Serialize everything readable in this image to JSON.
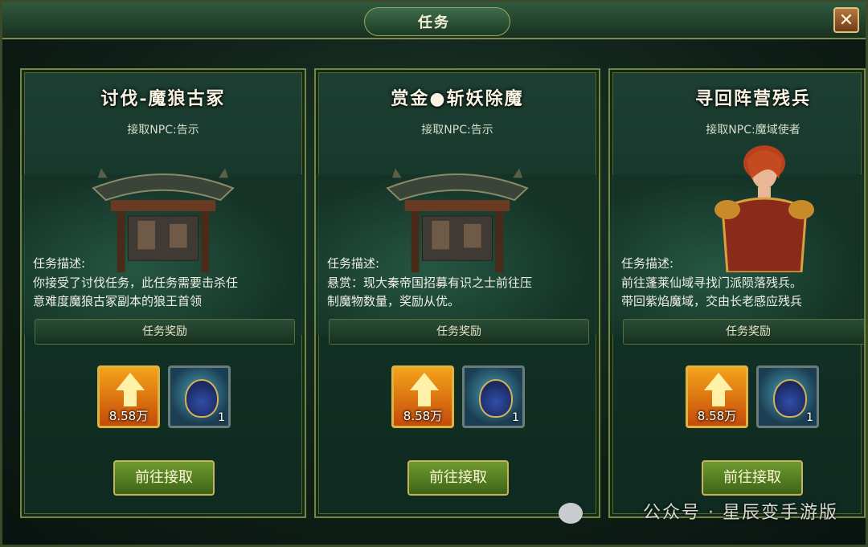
{
  "window": {
    "title": "任务",
    "close_icon": "close-icon"
  },
  "cards": [
    {
      "title": "讨伐-魔狼古冢",
      "npc_label": "接取NPC:",
      "npc_name": "告示",
      "art": "notice-board-icon",
      "desc_label": "任务描述:",
      "desc_lines": [
        "你接受了讨伐任务，此任务需要击杀任",
        "意难度魔狼古冢副本的狼王首领"
      ],
      "reward_label": "任务奖励",
      "exp_amount": "8.58万",
      "item_count": "1",
      "button_label": "前往接取"
    },
    {
      "title": "赏金●斩妖除魔",
      "npc_label": "接取NPC:",
      "npc_name": "告示",
      "art": "notice-board-icon",
      "desc_label": "任务描述:",
      "desc_lines": [
        "悬赏：现大秦帝国招募有识之士前往压",
        "制魔物数量，奖励从优。"
      ],
      "reward_label": "任务奖励",
      "exp_amount": "8.58万",
      "item_count": "1",
      "button_label": "前往接取"
    },
    {
      "title": "寻回阵营残兵",
      "npc_label": "接取NPC:",
      "npc_name": "魔域使者",
      "art": "npc-portrait-icon",
      "desc_label": "任务描述:",
      "desc_lines": [
        "前往蓬莱仙域寻找门派陨落残兵。",
        "带回紫焰魔域，交由长老感应残兵"
      ],
      "reward_label": "任务奖励",
      "exp_amount": "8.58万",
      "item_count": "1",
      "button_label": "前往接取"
    }
  ],
  "watermark": {
    "text": "公众号 · 星辰变手游版",
    "icon": "wechat-icon"
  },
  "colors": {
    "accent_gold": "#e0b23e",
    "button_green": "#6f9a2e",
    "panel_border": "#6f8a3c"
  }
}
